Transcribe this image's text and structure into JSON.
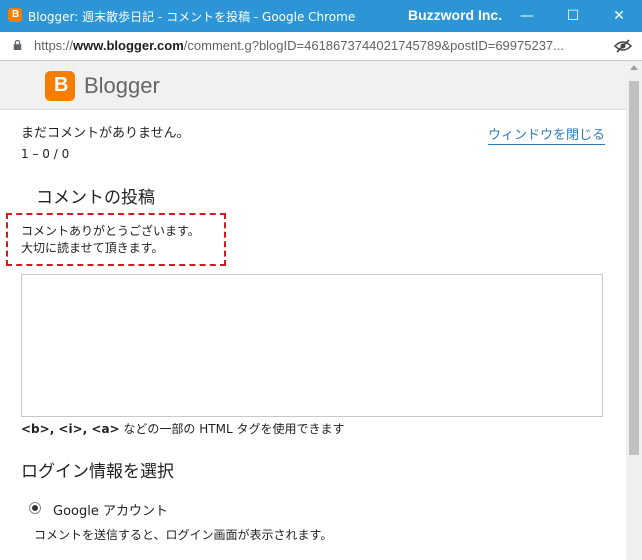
{
  "window": {
    "title": "Blogger: 週末散歩日記 - コメントを投稿 - Google Chrome",
    "brand": "Buzzword Inc.",
    "minimize": "—",
    "maximize": "☐",
    "close": "✕"
  },
  "address": {
    "scheme": "https://",
    "host": "www.blogger.com",
    "path": "/comment.g?blogID=4618673744021745789&postID=69975237..."
  },
  "header": {
    "logo_letter": "B",
    "logo_text": "Blogger"
  },
  "comments": {
    "empty_text": "まだコメントがありません。",
    "close_window": "ウィンドウを閉じる",
    "pager": "1 – 0 / 0"
  },
  "post": {
    "title": "コメントの投稿",
    "message_line1": "コメントありがとうございます。",
    "message_line2": "大切に読ませて頂きます。",
    "textarea_value": "",
    "html_tags": "<b>, <i>, <a>",
    "html_note": " などの一部の HTML タグを使用できます"
  },
  "login": {
    "title": "ログイン情報を選択",
    "option": "Google アカウント",
    "note": "コメントを送信すると、ログイン画面が表示されます。"
  },
  "colors": {
    "titlebar": "#2b95d6",
    "accent": "#f57d00",
    "link": "#2e7bbd",
    "highlight": "#d01c1c"
  }
}
